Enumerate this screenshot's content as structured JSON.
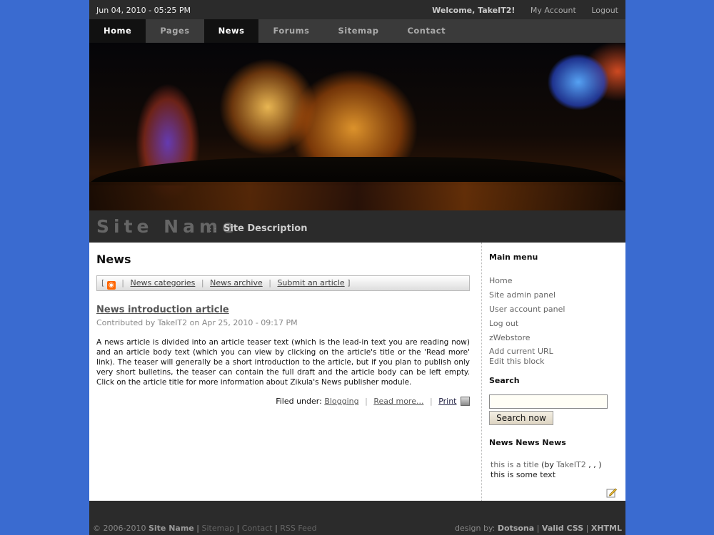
{
  "topbar": {
    "date": "Jun 04, 2010 - 05:25 PM",
    "welcome": "Welcome, TakeIT2!",
    "my_account": "My Account",
    "logout": "Logout"
  },
  "nav": {
    "tabs": [
      {
        "label": "Home"
      },
      {
        "label": "Pages"
      },
      {
        "label": "News"
      },
      {
        "label": "Forums"
      },
      {
        "label": "Sitemap"
      },
      {
        "label": "Contact"
      }
    ]
  },
  "site": {
    "name": "Site Name",
    "separator": ": :",
    "description": "Site Description"
  },
  "main": {
    "title": "News",
    "toolbar": {
      "open": "[",
      "close": "]",
      "sep": "|",
      "links": [
        "News categories",
        "News archive",
        "Submit an article"
      ]
    },
    "article": {
      "title": "News introduction article",
      "meta": "Contributed by TakeIT2 on Apr 25, 2010 - 09:17 PM",
      "body": "A news article is divided into an article teaser text (which is the lead-in text you are reading now) and an article body text (which you can view by clicking on the article's title or the 'Read more' link). The teaser will generally be a short introduction to the article, but if you plan to publish only very short bulletins, the teaser can contain the full draft and the article body can be left empty. Click on the article title for more information about Zikula's News publisher module.",
      "filed_under": "Filed under:",
      "category": "Blogging",
      "read_more": "Read more...",
      "print": "Print"
    }
  },
  "sidebar": {
    "main_menu_title": "Main menu",
    "menu": [
      "Home",
      "Site admin panel",
      "User account panel",
      "Log out",
      "zWebstore"
    ],
    "extra": [
      "Add current URL",
      "Edit this block"
    ],
    "search_title": "Search",
    "search_value": "",
    "search_button": "Search now",
    "news_title": "News News News",
    "news_item": {
      "title": "this is a title",
      "by_open": "(by",
      "author": "TakeIT2",
      "by_close": ", , )",
      "text": "this is some text"
    }
  },
  "footer": {
    "copyright": "© 2006-2010",
    "site_name": "Site Name",
    "links": [
      "Sitemap",
      "Contact",
      "RSS Feed"
    ],
    "design_by": "design by:",
    "designer": "Dotsona",
    "valid_css": "Valid CSS",
    "xhtml": "XHTML",
    "sep": "|"
  }
}
